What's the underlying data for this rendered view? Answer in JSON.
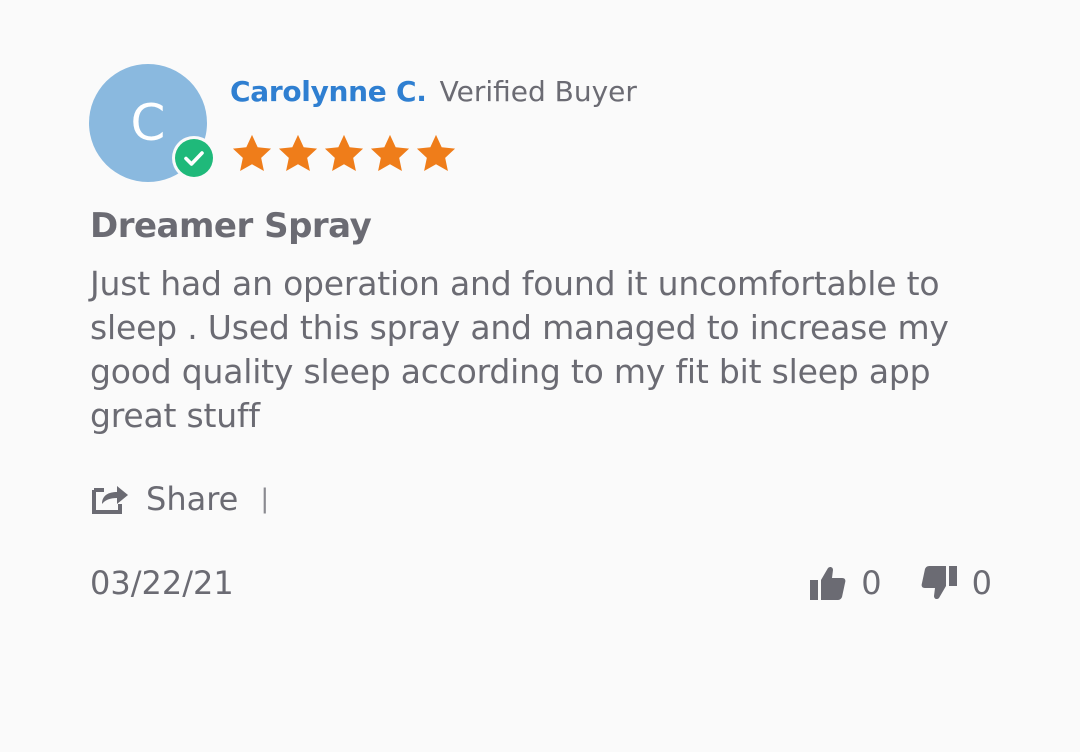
{
  "review": {
    "avatar_initial": "C",
    "reviewer_name": "Carolynne C.",
    "verified_label": "Verified Buyer",
    "rating": 5,
    "rating_max": 5,
    "title": "Dreamer Spray",
    "body": "Just had an operation and found it uncomfortable to sleep . Used this spray and managed to increase my good quality sleep according to my fit bit sleep app great stuff",
    "share_label": "Share",
    "separator": "|",
    "date": "03/22/21",
    "thumbs_up_count": "0",
    "thumbs_down_count": "0"
  },
  "icons": {
    "verified": "verified-check-icon",
    "star": "star-icon",
    "share": "share-icon",
    "thumbs_up": "thumbs-up-icon",
    "thumbs_down": "thumbs-down-icon"
  },
  "colors": {
    "avatar_bg": "#8ab9df",
    "name": "#2f7fd1",
    "star": "#ef7d1a",
    "verified_badge": "#1fb97a",
    "text": "#6b6b73",
    "background": "#fafafa"
  }
}
